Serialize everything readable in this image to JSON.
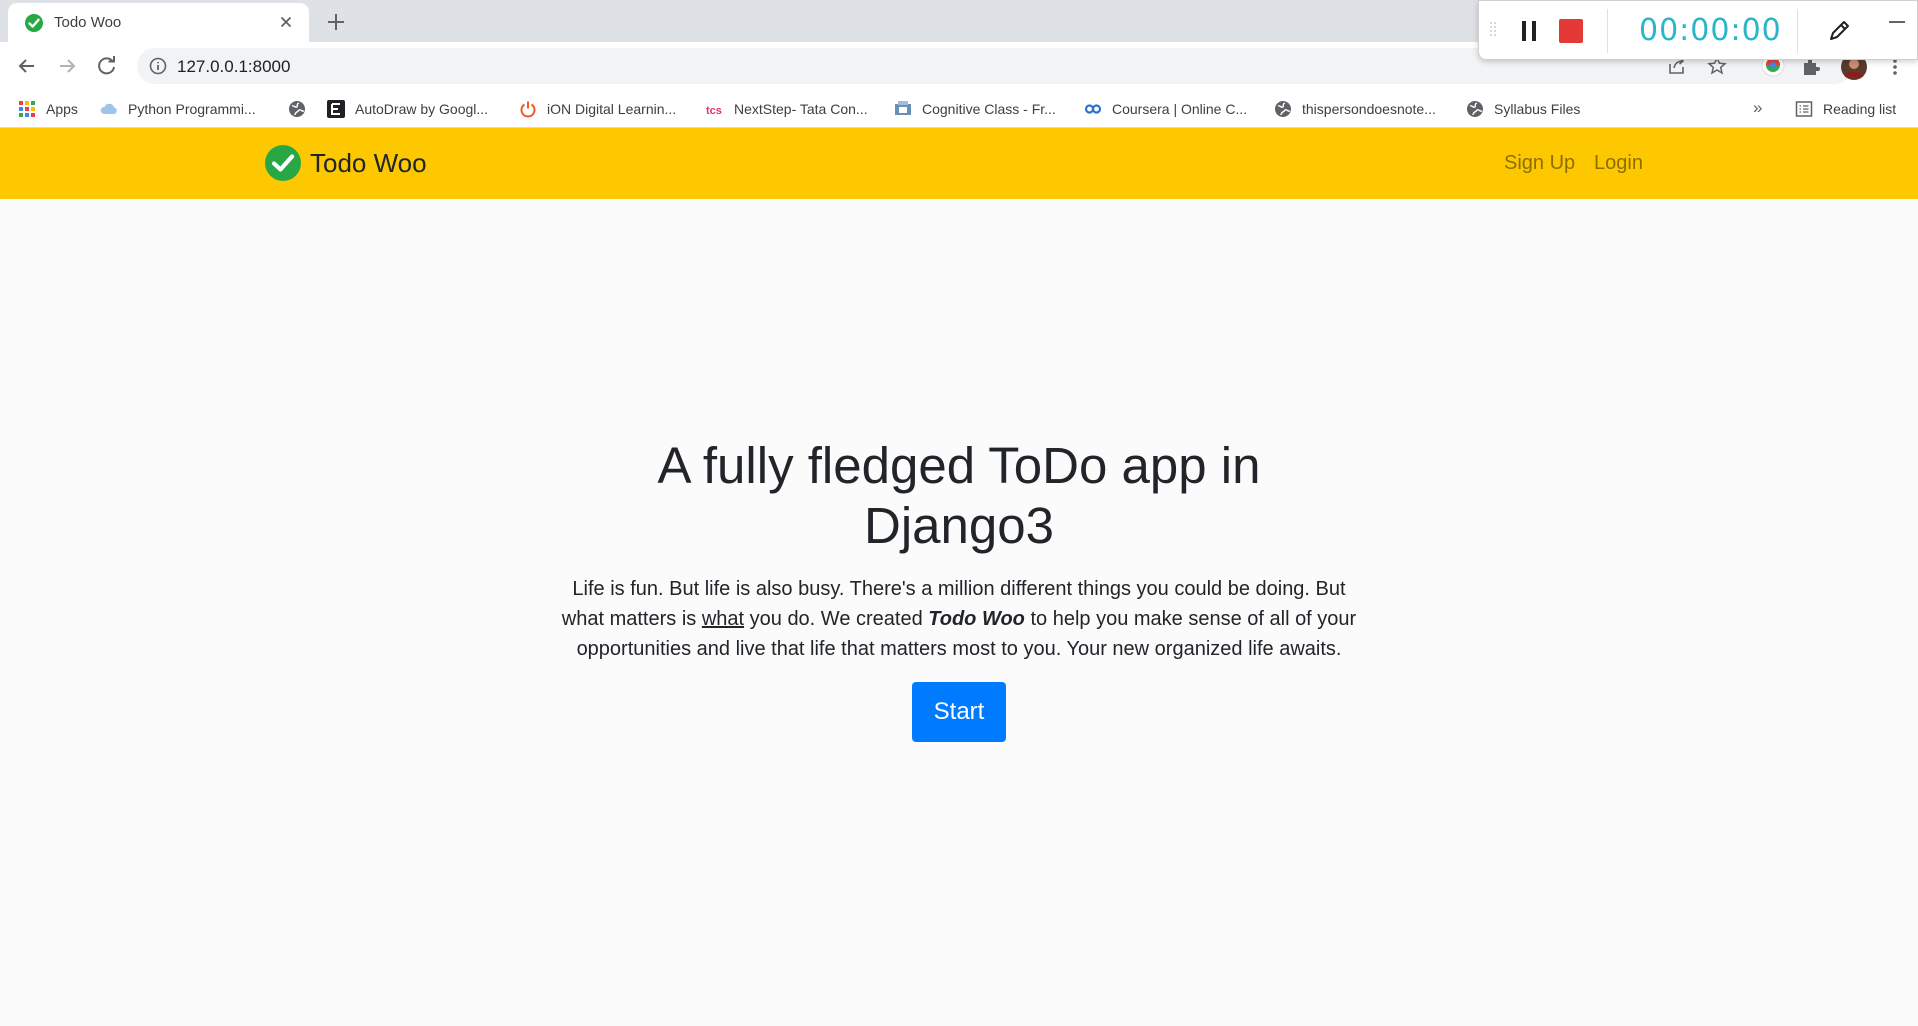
{
  "browser": {
    "tab": {
      "title": "Todo Woo",
      "favicon": "green-check-icon"
    },
    "url": "127.0.0.1:8000",
    "bookmarks": [
      {
        "label": "Apps",
        "icon": "apps-grid-icon"
      },
      {
        "label": "Python Programmi...",
        "icon": "cloud-icon"
      },
      {
        "label": "",
        "icon": "globe-icon"
      },
      {
        "label": "AutoDraw by Googl...",
        "icon": "autodraw-icon"
      },
      {
        "label": "iON Digital Learnin...",
        "icon": "power-icon"
      },
      {
        "label": "NextStep- Tata Con...",
        "icon": "tcs-icon"
      },
      {
        "label": "Cognitive Class - Fr...",
        "icon": "cognitive-class-icon"
      },
      {
        "label": "Coursera | Online C...",
        "icon": "coursera-icon"
      },
      {
        "label": "thispersondoesnote...",
        "icon": "globe-icon"
      },
      {
        "label": "Syllabus Files",
        "icon": "globe-icon"
      }
    ],
    "more_bookmarks": "»",
    "reading_list": "Reading list"
  },
  "recorder": {
    "timer": "00:00:00",
    "colors": {
      "timer": "#29b6c8",
      "stop": "#e53935"
    }
  },
  "navbar": {
    "brand": "Todo Woo",
    "links": [
      "Sign Up",
      "Login"
    ],
    "colors": {
      "background": "#fec800",
      "link": "#8c6e00"
    }
  },
  "hero": {
    "headline": "A fully fledged ToDo app in Django3",
    "lead": {
      "part1": "Life is fun. But life is also busy. There's a million different things you could be doing. But what matters is ",
      "underlined": "what",
      "part2": " you do. We created ",
      "emphasis": "Todo Woo",
      "part3": " to help you make sense of all of your opportunities and live that life that matters most to you. Your new organized life awaits."
    },
    "button": "Start",
    "colors": {
      "button": "#007bff"
    }
  }
}
